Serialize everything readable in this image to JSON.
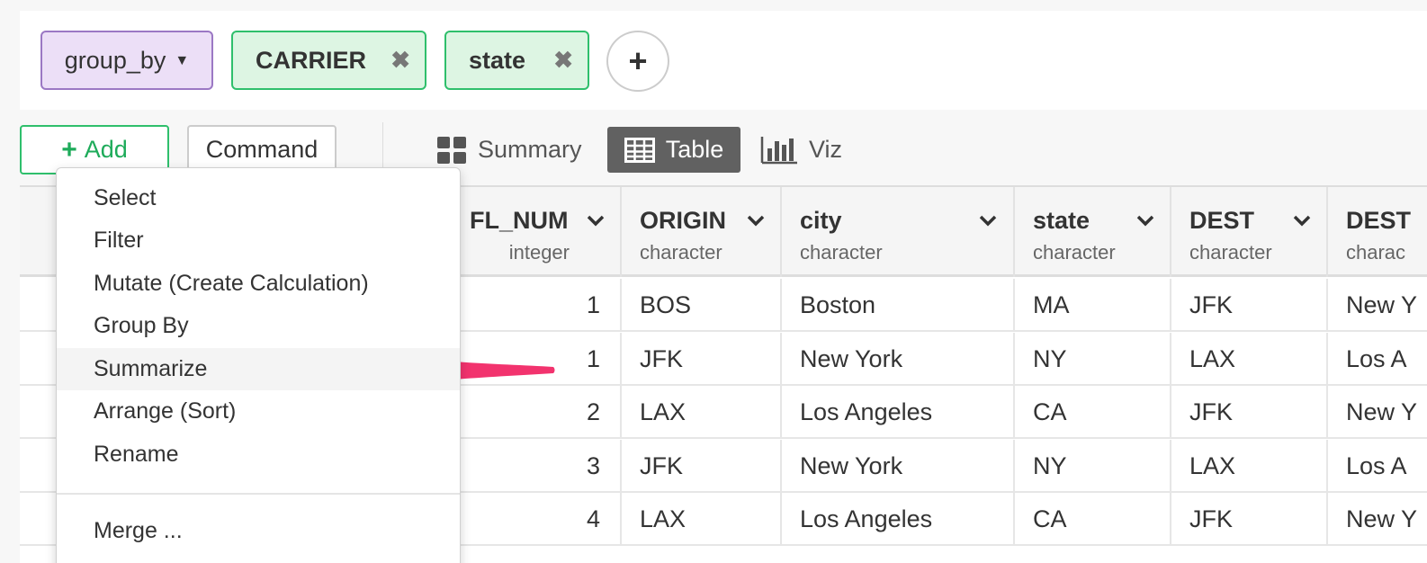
{
  "steps": {
    "group_by_label": "group_by",
    "chips": [
      {
        "label": "CARRIER"
      },
      {
        "label": "state"
      }
    ]
  },
  "toolbar": {
    "add_label": "Add",
    "command_label": "Command",
    "views": [
      "Summary",
      "Table",
      "Viz"
    ],
    "active_view": "Table"
  },
  "table": {
    "columns": [
      {
        "name": "FL_NUM",
        "type": "integer"
      },
      {
        "name": "ORIGIN",
        "type": "character"
      },
      {
        "name": "city",
        "type": "character"
      },
      {
        "name": "state",
        "type": "character"
      },
      {
        "name": "DEST",
        "type": "character"
      },
      {
        "name": "DEST",
        "type": "charac"
      }
    ],
    "rows": [
      [
        "1",
        "BOS",
        "Boston",
        "MA",
        "JFK",
        "New Y"
      ],
      [
        "1",
        "JFK",
        "New York",
        "NY",
        "LAX",
        "Los A"
      ],
      [
        "2",
        "LAX",
        "Los Angeles",
        "CA",
        "JFK",
        "New Y"
      ],
      [
        "3",
        "JFK",
        "New York",
        "NY",
        "LAX",
        "Los A"
      ],
      [
        "4",
        "LAX",
        "Los Angeles",
        "CA",
        "JFK",
        "New Y"
      ]
    ]
  },
  "add_menu": {
    "items": [
      "Select",
      "Filter",
      "Mutate (Create Calculation)",
      "Group By",
      "Summarize",
      "Arrange (Sort)",
      "Rename"
    ],
    "highlighted": "Summarize",
    "footer_item": "Merge ..."
  },
  "colors": {
    "annotation_arrow": "#f2336e",
    "accent_green": "#2fbf6c",
    "group_purple": "#9b78c4"
  }
}
